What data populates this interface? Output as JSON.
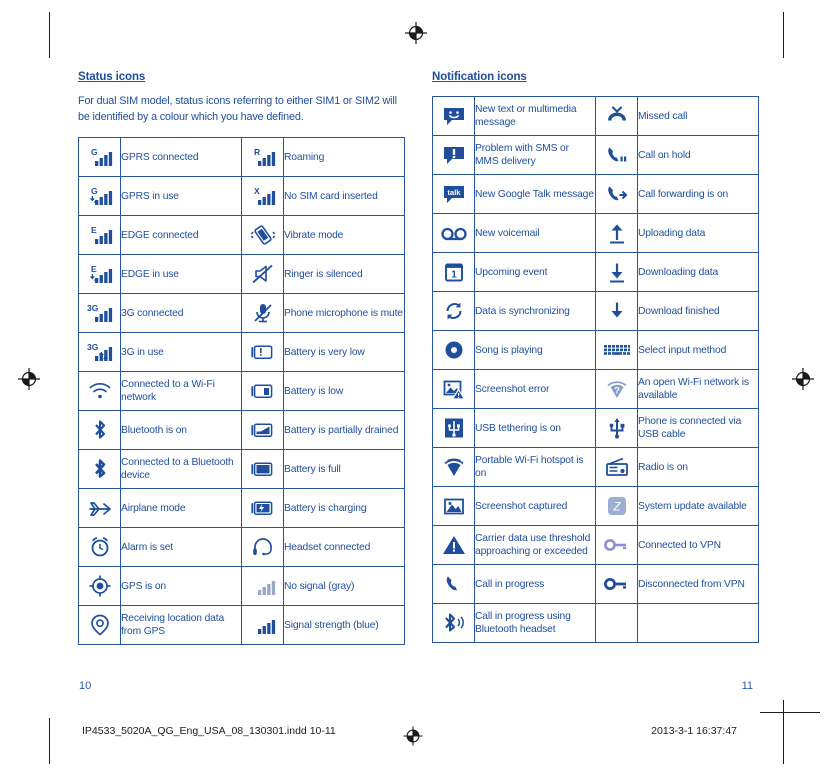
{
  "document": {
    "accent_color": "#1f4e9c",
    "border_color": "#26559e",
    "vpn_connected_color": "#8b8fd0"
  },
  "left_page": {
    "section_title": "Status icons",
    "intro": "For dual SIM model, status icons referring to either SIM1 or SIM2 will be identified by a colour which you have defined.",
    "page_number": "10",
    "rows": [
      {
        "icon_a": "signal-bars-g-icon",
        "label_a": "GPRS connected",
        "icon_b": "signal-bars-r-icon",
        "label_b": "Roaming"
      },
      {
        "icon_a": "signal-bars-g-active-icon",
        "label_a": "GPRS in use",
        "icon_b": "signal-bars-x-icon",
        "label_b": "No SIM card inserted"
      },
      {
        "icon_a": "signal-bars-e-icon",
        "label_a": "EDGE connected",
        "icon_b": "vibrate-icon",
        "label_b": "Vibrate mode"
      },
      {
        "icon_a": "signal-bars-e-active-icon",
        "label_a": "EDGE in use",
        "icon_b": "ringer-silenced-icon",
        "label_b": "Ringer is silenced"
      },
      {
        "icon_a": "signal-bars-3g-icon",
        "label_a": "3G connected",
        "icon_b": "microphone-mute-icon",
        "label_b": "Phone microphone is mute"
      },
      {
        "icon_a": "signal-bars-3g-active-icon",
        "label_a": "3G in use",
        "icon_b": "battery-very-low-icon",
        "label_b": "Battery is very low"
      },
      {
        "icon_a": "wifi-connected-icon",
        "label_a": "Connected to a Wi-Fi network",
        "icon_b": "battery-low-icon",
        "label_b": "Battery is low"
      },
      {
        "icon_a": "bluetooth-on-icon",
        "label_a": "Bluetooth is on",
        "icon_b": "battery-partial-icon",
        "label_b": "Battery is partially drained"
      },
      {
        "icon_a": "bluetooth-connected-icon",
        "label_a": "Connected to a Bluetooth device",
        "icon_b": "battery-full-icon",
        "label_b": "Battery is full"
      },
      {
        "icon_a": "airplane-mode-icon",
        "label_a": "Airplane mode",
        "icon_b": "battery-charging-icon",
        "label_b": "Battery is charging"
      },
      {
        "icon_a": "alarm-clock-icon",
        "label_a": "Alarm is set",
        "icon_b": "headset-icon",
        "label_b": "Headset connected"
      },
      {
        "icon_a": "gps-on-icon",
        "label_a": "GPS is on",
        "icon_b": "signal-no-gray-icon",
        "label_b": "No signal (gray)"
      },
      {
        "icon_a": "gps-receiving-icon",
        "label_a": "Receiving location data from GPS",
        "icon_b": "signal-strength-blue-icon",
        "label_b": "Signal strength (blue)"
      }
    ]
  },
  "right_page": {
    "section_title": "Notification icons",
    "page_number": "11",
    "rows": [
      {
        "icon_a": "message-smiley-icon",
        "label_a": "New text or multimedia message",
        "icon_b": "missed-call-icon",
        "label_b": "Missed call"
      },
      {
        "icon_a": "message-problem-icon",
        "label_a": "Problem with SMS or MMS delivery",
        "icon_b": "call-on-hold-icon",
        "label_b": "Call on hold"
      },
      {
        "icon_a": "google-talk-icon",
        "label_a": "New Google Talk message",
        "icon_b": "call-forwarding-icon",
        "label_b": "Call forwarding is on"
      },
      {
        "icon_a": "voicemail-icon",
        "label_a": "New voicemail",
        "icon_b": "upload-arrow-icon",
        "label_b": "Uploading data"
      },
      {
        "icon_a": "calendar-event-icon",
        "label_a": "Upcoming event",
        "icon_b": "download-arrow-icon",
        "label_b": "Downloading data"
      },
      {
        "icon_a": "sync-icon",
        "label_a": "Data is synchronizing",
        "icon_b": "download-finished-icon",
        "label_b": "Download finished"
      },
      {
        "icon_a": "music-playing-icon",
        "label_a": "Song is playing",
        "icon_b": "keyboard-icon",
        "label_b": "Select input method"
      },
      {
        "icon_a": "screenshot-error-icon",
        "label_a": "Screenshot error",
        "icon_b": "wifi-open-network-icon",
        "label_b": "An open Wi-Fi network is available"
      },
      {
        "icon_a": "usb-tethering-icon",
        "label_a": "USB tethering is on",
        "icon_b": "usb-cable-icon",
        "label_b": "Phone is connected via USB cable"
      },
      {
        "icon_a": "wifi-hotspot-icon",
        "label_a": "Portable Wi-Fi hotspot is on",
        "icon_b": "radio-icon",
        "label_b": "Radio is on"
      },
      {
        "icon_a": "screenshot-captured-icon",
        "label_a": "Screenshot captured",
        "icon_b": "system-update-icon",
        "label_b": "System update available"
      },
      {
        "icon_a": "warning-triangle-icon",
        "label_a": "Carrier data use threshold approaching or exceeded",
        "icon_b": "vpn-connected-icon",
        "label_b": "Connected to VPN"
      },
      {
        "icon_a": "call-in-progress-icon",
        "label_a": "Call in progress",
        "icon_b": "vpn-disconnected-icon",
        "label_b": "Disconnected from VPN"
      },
      {
        "icon_a": "bluetooth-call-icon",
        "label_a": "Call in progress using Bluetooth headset",
        "icon_b": "",
        "label_b": ""
      }
    ]
  },
  "print_meta": {
    "filename": "IP4533_5020A_QG_Eng_USA_08_130301.indd   10-11",
    "timestamp": "2013-3-1   16:37:47"
  }
}
